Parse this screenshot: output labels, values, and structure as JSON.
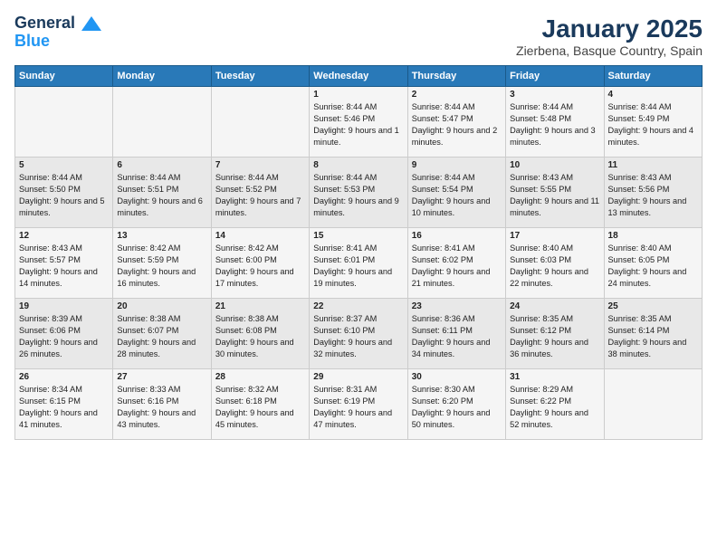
{
  "header": {
    "logo_line1": "General",
    "logo_line2": "Blue",
    "month": "January 2025",
    "location": "Zierbena, Basque Country, Spain"
  },
  "days_of_week": [
    "Sunday",
    "Monday",
    "Tuesday",
    "Wednesday",
    "Thursday",
    "Friday",
    "Saturday"
  ],
  "weeks": [
    [
      {
        "day": "",
        "text": ""
      },
      {
        "day": "",
        "text": ""
      },
      {
        "day": "",
        "text": ""
      },
      {
        "day": "1",
        "text": "Sunrise: 8:44 AM\nSunset: 5:46 PM\nDaylight: 9 hours and 1 minute."
      },
      {
        "day": "2",
        "text": "Sunrise: 8:44 AM\nSunset: 5:47 PM\nDaylight: 9 hours and 2 minutes."
      },
      {
        "day": "3",
        "text": "Sunrise: 8:44 AM\nSunset: 5:48 PM\nDaylight: 9 hours and 3 minutes."
      },
      {
        "day": "4",
        "text": "Sunrise: 8:44 AM\nSunset: 5:49 PM\nDaylight: 9 hours and 4 minutes."
      }
    ],
    [
      {
        "day": "5",
        "text": "Sunrise: 8:44 AM\nSunset: 5:50 PM\nDaylight: 9 hours and 5 minutes."
      },
      {
        "day": "6",
        "text": "Sunrise: 8:44 AM\nSunset: 5:51 PM\nDaylight: 9 hours and 6 minutes."
      },
      {
        "day": "7",
        "text": "Sunrise: 8:44 AM\nSunset: 5:52 PM\nDaylight: 9 hours and 7 minutes."
      },
      {
        "day": "8",
        "text": "Sunrise: 8:44 AM\nSunset: 5:53 PM\nDaylight: 9 hours and 9 minutes."
      },
      {
        "day": "9",
        "text": "Sunrise: 8:44 AM\nSunset: 5:54 PM\nDaylight: 9 hours and 10 minutes."
      },
      {
        "day": "10",
        "text": "Sunrise: 8:43 AM\nSunset: 5:55 PM\nDaylight: 9 hours and 11 minutes."
      },
      {
        "day": "11",
        "text": "Sunrise: 8:43 AM\nSunset: 5:56 PM\nDaylight: 9 hours and 13 minutes."
      }
    ],
    [
      {
        "day": "12",
        "text": "Sunrise: 8:43 AM\nSunset: 5:57 PM\nDaylight: 9 hours and 14 minutes."
      },
      {
        "day": "13",
        "text": "Sunrise: 8:42 AM\nSunset: 5:59 PM\nDaylight: 9 hours and 16 minutes."
      },
      {
        "day": "14",
        "text": "Sunrise: 8:42 AM\nSunset: 6:00 PM\nDaylight: 9 hours and 17 minutes."
      },
      {
        "day": "15",
        "text": "Sunrise: 8:41 AM\nSunset: 6:01 PM\nDaylight: 9 hours and 19 minutes."
      },
      {
        "day": "16",
        "text": "Sunrise: 8:41 AM\nSunset: 6:02 PM\nDaylight: 9 hours and 21 minutes."
      },
      {
        "day": "17",
        "text": "Sunrise: 8:40 AM\nSunset: 6:03 PM\nDaylight: 9 hours and 22 minutes."
      },
      {
        "day": "18",
        "text": "Sunrise: 8:40 AM\nSunset: 6:05 PM\nDaylight: 9 hours and 24 minutes."
      }
    ],
    [
      {
        "day": "19",
        "text": "Sunrise: 8:39 AM\nSunset: 6:06 PM\nDaylight: 9 hours and 26 minutes."
      },
      {
        "day": "20",
        "text": "Sunrise: 8:38 AM\nSunset: 6:07 PM\nDaylight: 9 hours and 28 minutes."
      },
      {
        "day": "21",
        "text": "Sunrise: 8:38 AM\nSunset: 6:08 PM\nDaylight: 9 hours and 30 minutes."
      },
      {
        "day": "22",
        "text": "Sunrise: 8:37 AM\nSunset: 6:10 PM\nDaylight: 9 hours and 32 minutes."
      },
      {
        "day": "23",
        "text": "Sunrise: 8:36 AM\nSunset: 6:11 PM\nDaylight: 9 hours and 34 minutes."
      },
      {
        "day": "24",
        "text": "Sunrise: 8:35 AM\nSunset: 6:12 PM\nDaylight: 9 hours and 36 minutes."
      },
      {
        "day": "25",
        "text": "Sunrise: 8:35 AM\nSunset: 6:14 PM\nDaylight: 9 hours and 38 minutes."
      }
    ],
    [
      {
        "day": "26",
        "text": "Sunrise: 8:34 AM\nSunset: 6:15 PM\nDaylight: 9 hours and 41 minutes."
      },
      {
        "day": "27",
        "text": "Sunrise: 8:33 AM\nSunset: 6:16 PM\nDaylight: 9 hours and 43 minutes."
      },
      {
        "day": "28",
        "text": "Sunrise: 8:32 AM\nSunset: 6:18 PM\nDaylight: 9 hours and 45 minutes."
      },
      {
        "day": "29",
        "text": "Sunrise: 8:31 AM\nSunset: 6:19 PM\nDaylight: 9 hours and 47 minutes."
      },
      {
        "day": "30",
        "text": "Sunrise: 8:30 AM\nSunset: 6:20 PM\nDaylight: 9 hours and 50 minutes."
      },
      {
        "day": "31",
        "text": "Sunrise: 8:29 AM\nSunset: 6:22 PM\nDaylight: 9 hours and 52 minutes."
      },
      {
        "day": "",
        "text": ""
      }
    ]
  ]
}
